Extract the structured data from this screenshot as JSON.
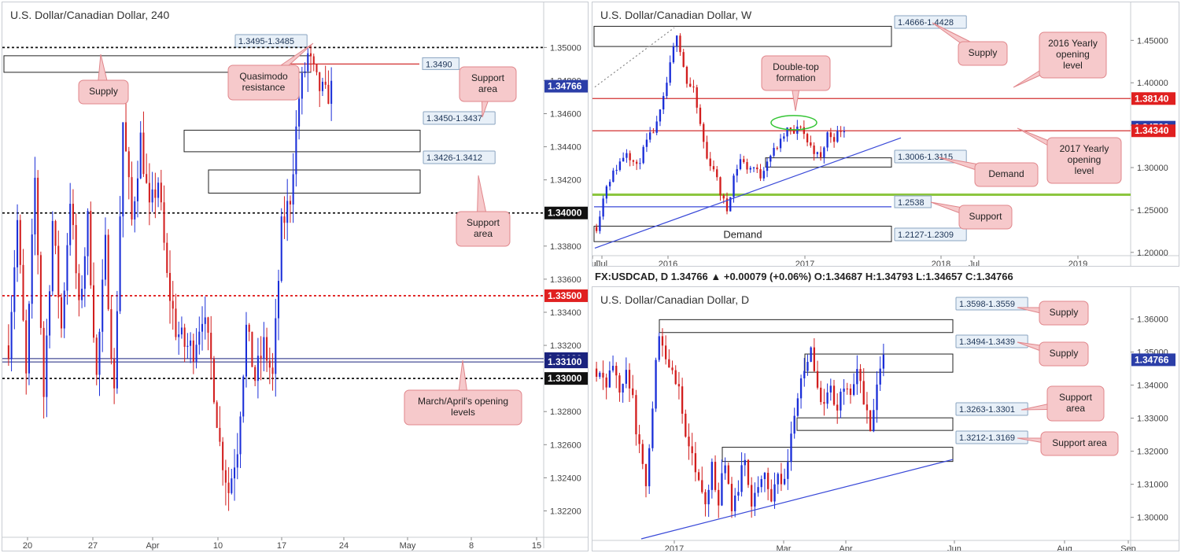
{
  "colors": {
    "up": "#1a2ed8",
    "down": "#d21e1e",
    "wick": "#444444",
    "callout_bg": "#f6c9cb",
    "callout_border": "#e0868b",
    "axis_text": "#444444",
    "price_blue": "#2b3ea8",
    "price_red": "#e02020",
    "green": "#8cc63f"
  },
  "header_bar": {
    "text": "FX:USDCAD, D 1.34766 ▲ +0.00079 (+0.06%) O:1.34687 H:1.34793 L:1.34657 C:1.34766"
  },
  "chart_data": [
    {
      "id": "h4",
      "type": "candlestick",
      "title": "U.S. Dollar/Canadian Dollar, 240",
      "ylim": [
        1.3205,
        1.3513
      ],
      "yticks": [
        "1.35000",
        "1.34800",
        "1.34600",
        "1.34400",
        "1.34200",
        "1.33800",
        "1.33600",
        "1.33400",
        "1.33200",
        "1.32800",
        "1.32600",
        "1.32400",
        "1.32200"
      ],
      "xticks": [
        "20",
        "27",
        "Apr",
        "10",
        "17",
        "24",
        "May",
        "8",
        "15"
      ],
      "price_labels": [
        {
          "text": "1.34766",
          "style": "blue"
        },
        {
          "text": "1.34000",
          "style": "black"
        },
        {
          "text": "1.33500",
          "style": "red"
        },
        {
          "text": "1.33120",
          "style": "navy"
        },
        {
          "text": "1.33100",
          "style": "navy"
        },
        {
          "text": "1.33000",
          "style": "black"
        }
      ],
      "levels": [
        {
          "value": 1.35,
          "style": "dash-black"
        },
        {
          "value": 1.349,
          "style": "solid-red",
          "label": "1.3490"
        },
        {
          "value": 1.34,
          "style": "dash-black"
        },
        {
          "value": 1.335,
          "style": "dash-red"
        },
        {
          "value": 1.3312,
          "style": "solid-navy"
        },
        {
          "value": 1.331,
          "style": "solid-navy"
        },
        {
          "value": 1.33,
          "style": "dash-black"
        }
      ],
      "zones": [
        {
          "label": "1.3495-1.3485",
          "high": 1.3495,
          "low": 1.3485
        },
        {
          "label": "1.3450-1.3437",
          "high": 1.345,
          "low": 1.3437
        },
        {
          "label": "1.3426-1.3412",
          "high": 1.3426,
          "low": 1.3412
        }
      ],
      "callouts": [
        "Supply",
        "Quasimodo resistance",
        "Support area",
        "Support area",
        "March/April's opening levels"
      ],
      "series_path": [
        [
          0,
          1.332
        ],
        [
          3,
          1.3395
        ],
        [
          6,
          1.33
        ],
        [
          9,
          1.342
        ],
        [
          12,
          1.329
        ],
        [
          15,
          1.3395
        ],
        [
          18,
          1.333
        ],
        [
          21,
          1.341
        ],
        [
          24,
          1.334
        ],
        [
          27,
          1.3395
        ],
        [
          30,
          1.33
        ],
        [
          33,
          1.338
        ],
        [
          36,
          1.329
        ],
        [
          39,
          1.3455
        ],
        [
          42,
          1.3395
        ],
        [
          45,
          1.3445
        ],
        [
          48,
          1.34
        ],
        [
          51,
          1.342
        ],
        [
          54,
          1.336
        ],
        [
          57,
          1.333
        ],
        [
          60,
          1.332
        ],
        [
          63,
          1.3318
        ],
        [
          66,
          1.334
        ],
        [
          69,
          1.331
        ],
        [
          72,
          1.326
        ],
        [
          75,
          1.3232
        ],
        [
          78,
          1.326
        ],
        [
          81,
          1.333
        ],
        [
          84,
          1.33
        ],
        [
          87,
          1.332
        ],
        [
          90,
          1.33
        ],
        [
          93,
          1.339
        ],
        [
          96,
          1.341
        ],
        [
          99,
          1.347
        ],
        [
          102,
          1.3495
        ],
        [
          105,
          1.3478
        ],
        [
          108,
          1.347
        ],
        [
          111,
          1.3477
        ]
      ],
      "candle_count": 111
    },
    {
      "id": "weekly",
      "type": "candlestick",
      "title": "U.S. Dollar/Canadian Dollar, W",
      "ylim": [
        1.198,
        1.467
      ],
      "yticks": [
        "1.45000",
        "1.40000",
        "1.35000",
        "1.30000",
        "1.25000",
        "1.20000"
      ],
      "xticks": [
        "Jul",
        "2016",
        "Jul",
        "2017",
        "Jul",
        "2018",
        "Jul",
        "2019"
      ],
      "price_labels": [
        {
          "text": "1.38140",
          "style": "red"
        },
        {
          "text": "1.34766",
          "style": "blue"
        },
        {
          "text": "1.34340",
          "style": "red"
        }
      ],
      "levels": [
        {
          "value": 1.3814,
          "style": "solid-red"
        },
        {
          "value": 1.3434,
          "style": "solid-red"
        },
        {
          "value": 1.268,
          "style": "thick-green"
        },
        {
          "value": 1.2538,
          "style": "solid-blue",
          "label": "1.2538"
        }
      ],
      "zones": [
        {
          "label": "1.4666-1.4428",
          "high": 1.4666,
          "low": 1.4428
        },
        {
          "label": "1.3006-1.3115",
          "high": 1.3115,
          "low": 1.3006
        },
        {
          "label": "1.2127-1.2309",
          "high": 1.2309,
          "low": 1.2127,
          "inner": "Demand"
        }
      ],
      "callouts": [
        "Supply",
        "2016 Yearly opening level",
        "Double-top formation",
        "2017 Yearly opening level",
        "Demand",
        "Support"
      ],
      "series_path": [
        [
          0,
          1.23
        ],
        [
          3,
          1.28
        ],
        [
          6,
          1.3
        ],
        [
          9,
          1.32
        ],
        [
          12,
          1.3
        ],
        [
          15,
          1.33
        ],
        [
          18,
          1.35
        ],
        [
          20,
          1.38
        ],
        [
          22,
          1.42
        ],
        [
          24,
          1.46
        ],
        [
          25,
          1.44
        ],
        [
          27,
          1.4
        ],
        [
          29,
          1.39
        ],
        [
          31,
          1.35
        ],
        [
          33,
          1.31
        ],
        [
          35,
          1.3
        ],
        [
          37,
          1.27
        ],
        [
          39,
          1.25
        ],
        [
          41,
          1.29
        ],
        [
          43,
          1.31
        ],
        [
          45,
          1.3
        ],
        [
          47,
          1.3
        ],
        [
          49,
          1.29
        ],
        [
          51,
          1.31
        ],
        [
          53,
          1.32
        ],
        [
          55,
          1.33
        ],
        [
          57,
          1.345
        ],
        [
          59,
          1.34
        ],
        [
          61,
          1.35
        ],
        [
          63,
          1.33
        ],
        [
          65,
          1.32
        ],
        [
          67,
          1.31
        ],
        [
          69,
          1.34
        ],
        [
          71,
          1.335
        ],
        [
          73,
          1.345
        ],
        [
          75,
          1.348
        ]
      ],
      "candle_count": 75
    },
    {
      "id": "daily",
      "type": "candlestick",
      "title": "U.S. Dollar/Canadian Dollar, D",
      "ylim": [
        1.2935,
        1.3625
      ],
      "yticks": [
        "1.36000",
        "1.35000",
        "1.34000",
        "1.33000",
        "1.32000",
        "1.31000",
        "1.30000"
      ],
      "xticks": [
        "2017",
        "Mar",
        "Apr",
        "Jun",
        "Aug",
        "Sep"
      ],
      "price_labels": [
        {
          "text": "1.34766",
          "style": "blue"
        }
      ],
      "zones": [
        {
          "label": "1.3598-1.3559",
          "high": 1.3598,
          "low": 1.3559
        },
        {
          "label": "1.3494-1.3439",
          "high": 1.3494,
          "low": 1.3439
        },
        {
          "label": "1.3263-1.3301",
          "high": 1.3301,
          "low": 1.3263
        },
        {
          "label": "1.3212-1.3169",
          "high": 1.3212,
          "low": 1.3169
        }
      ],
      "callouts": [
        "Supply",
        "Supply",
        "Support area",
        "Support area"
      ],
      "series_path": [
        [
          0,
          1.345
        ],
        [
          3,
          1.338
        ],
        [
          5,
          1.348
        ],
        [
          7,
          1.34
        ],
        [
          9,
          1.345
        ],
        [
          11,
          1.335
        ],
        [
          13,
          1.32
        ],
        [
          15,
          1.31
        ],
        [
          17,
          1.335
        ],
        [
          19,
          1.357
        ],
        [
          21,
          1.35
        ],
        [
          23,
          1.345
        ],
        [
          25,
          1.338
        ],
        [
          27,
          1.325
        ],
        [
          29,
          1.318
        ],
        [
          31,
          1.31
        ],
        [
          33,
          1.302
        ],
        [
          35,
          1.315
        ],
        [
          37,
          1.305
        ],
        [
          39,
          1.318
        ],
        [
          41,
          1.3
        ],
        [
          43,
          1.31
        ],
        [
          45,
          1.318
        ],
        [
          47,
          1.305
        ],
        [
          49,
          1.308
        ],
        [
          51,
          1.312
        ],
        [
          53,
          1.306
        ],
        [
          55,
          1.315
        ],
        [
          57,
          1.31
        ],
        [
          59,
          1.325
        ],
        [
          61,
          1.335
        ],
        [
          63,
          1.345
        ],
        [
          65,
          1.35
        ],
        [
          67,
          1.34
        ],
        [
          69,
          1.333
        ],
        [
          71,
          1.338
        ],
        [
          73,
          1.333
        ],
        [
          75,
          1.34
        ],
        [
          77,
          1.335
        ],
        [
          79,
          1.345
        ],
        [
          81,
          1.335
        ],
        [
          83,
          1.325
        ],
        [
          85,
          1.338
        ],
        [
          87,
          1.348
        ],
        [
          88,
          1.3477
        ]
      ],
      "candle_count": 88
    }
  ]
}
